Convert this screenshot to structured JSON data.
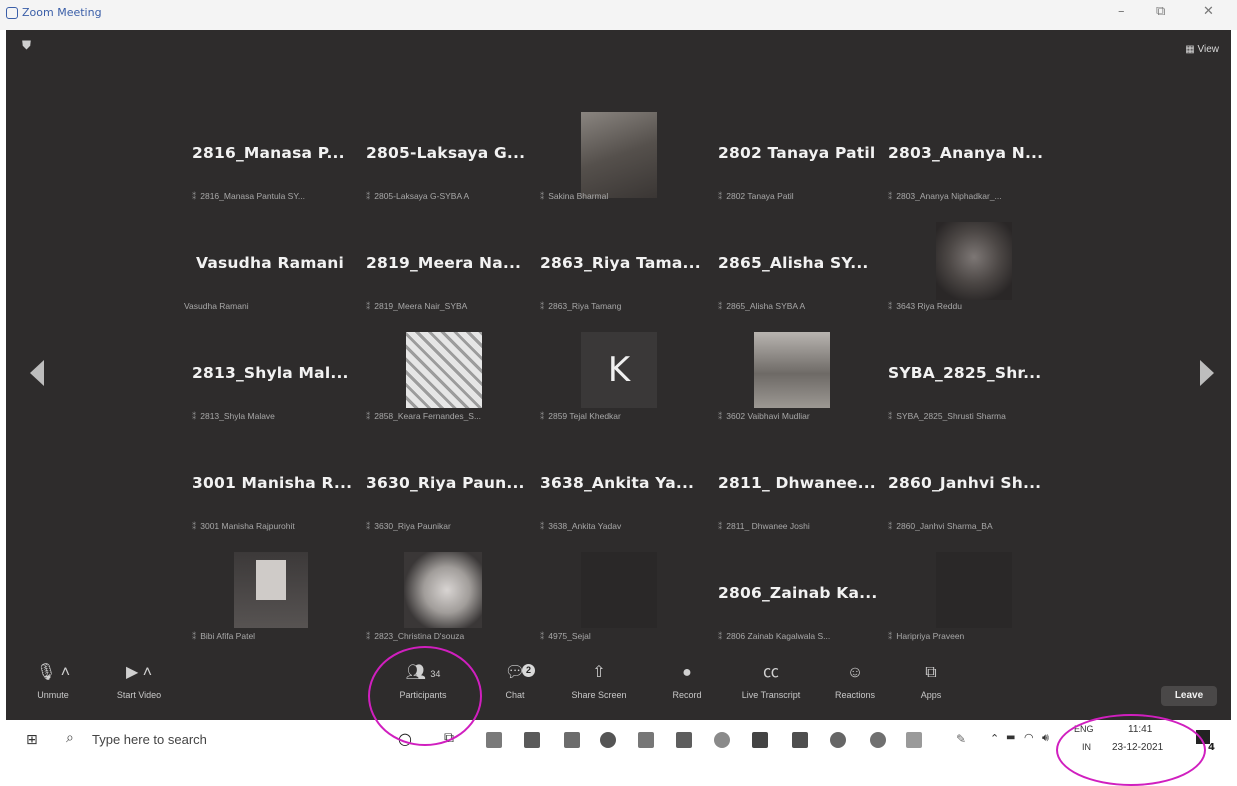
{
  "window": {
    "title": "Zoom Meeting",
    "minimize": "–",
    "restore": "⧉",
    "close": "✕"
  },
  "meeting": {
    "view_label": "View",
    "tiles": [
      {
        "name": "2816_Manasa P...",
        "sub": "2816_Manasa Pantula SY..."
      },
      {
        "name": "2805-Laksaya G...",
        "sub": "2805-Laksaya G-SYBA A"
      },
      {
        "name": "",
        "sub": "Sakina Bharmal",
        "video": true
      },
      {
        "name": "2802 Tanaya Patil",
        "sub": "2802 Tanaya Patil"
      },
      {
        "name": "2803_Ananya N...",
        "sub": "2803_Ananya Niphadkar_..."
      },
      {
        "name": "Vasudha Ramani",
        "sub": "Vasudha Ramani"
      },
      {
        "name": "2819_Meera Na...",
        "sub": "2819_Meera Nair_SYBA"
      },
      {
        "name": "2863_Riya Tama...",
        "sub": "2863_Riya Tamang"
      },
      {
        "name": "2865_Alisha SY...",
        "sub": "2865_Alisha SYBA A"
      },
      {
        "name": "",
        "sub": "3643 Riya Reddu",
        "video": true
      },
      {
        "name": "2813_Shyla Mal...",
        "sub": "2813_Shyla Malave"
      },
      {
        "name": "",
        "sub": "2858_Keara Fernandes_S...",
        "video": true
      },
      {
        "name": "",
        "sub": "2859 Tejal Khedkar",
        "avatar": "K"
      },
      {
        "name": "",
        "sub": "3602 Vaibhavi Mudliar",
        "video": true
      },
      {
        "name": "SYBA_2825_Shr...",
        "sub": "SYBA_2825_Shrusti Sharma"
      },
      {
        "name": "3001 Manisha R...",
        "sub": "3001 Manisha Rajpurohit"
      },
      {
        "name": "3630_Riya Paun...",
        "sub": "3630_Riya Paunikar"
      },
      {
        "name": "3638_Ankita Ya...",
        "sub": "3638_Ankita Yadav"
      },
      {
        "name": "2811_ Dhwanee...",
        "sub": "2811_ Dhwanee Joshi"
      },
      {
        "name": "2860_Janhvi Sh...",
        "sub": "2860_Janhvi Sharma_BA"
      },
      {
        "name": "",
        "sub": "Bibi Afifa Patel",
        "video": true
      },
      {
        "name": "",
        "sub": "2823_Christina D'souza",
        "video": true
      },
      {
        "name": "",
        "sub": "4975_Sejal",
        "video": true
      },
      {
        "name": "2806_Zainab Ka...",
        "sub": "2806 Zainab Kagalwala S..."
      },
      {
        "name": "",
        "sub": "Haripriya Praveen",
        "video": true
      }
    ]
  },
  "toolbar": {
    "unmute": "Unmute",
    "start_video": "Start Video",
    "participants": "Participants",
    "participants_count": "34",
    "chat": "Chat",
    "chat_badge": "2",
    "share_screen": "Share Screen",
    "record": "Record",
    "live_transcript": "Live Transcript",
    "reactions": "Reactions",
    "apps": "Apps",
    "leave": "Leave"
  },
  "taskbar": {
    "search_placeholder": "Type here to search",
    "lang_top": "ENG",
    "lang_bottom": "IN",
    "time": "11:41",
    "date": "23-12-2021",
    "notif_count": "4"
  },
  "colors": {
    "meeting_bg": "#2e2c2c",
    "annotation": "#d01fbf",
    "taskbar_bg": "#ffffff"
  }
}
